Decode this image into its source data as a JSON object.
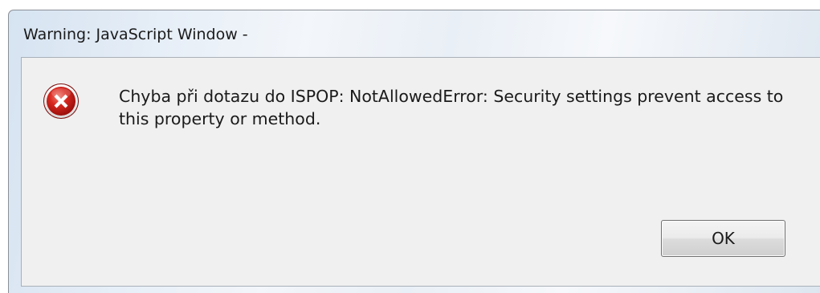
{
  "window": {
    "title": "Warning: JavaScript Window -"
  },
  "dialog": {
    "icon": "error-icon",
    "message": "Chyba při dotazu do ISPOP: NotAllowedError: Security settings prevent access to this property or method.",
    "ok_label": "OK"
  },
  "colors": {
    "error_red": "#c8181c",
    "titlebar_blue": "#dde6f0",
    "client_gray": "#f0f0f0"
  }
}
